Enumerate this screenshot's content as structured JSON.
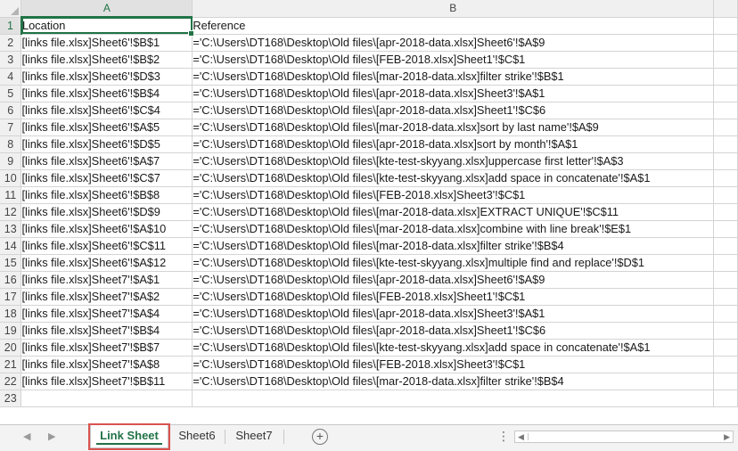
{
  "columns": [
    "A",
    "B"
  ],
  "rows": [
    {
      "n": "1",
      "a": "Location",
      "b": "Reference"
    },
    {
      "n": "2",
      "a": "[links file.xlsx]Sheet6'!$B$1",
      "b": "='C:\\Users\\DT168\\Desktop\\Old files\\[apr-2018-data.xlsx]Sheet6'!$A$9"
    },
    {
      "n": "3",
      "a": "[links file.xlsx]Sheet6'!$B$2",
      "b": "='C:\\Users\\DT168\\Desktop\\Old files\\[FEB-2018.xlsx]Sheet1'!$C$1"
    },
    {
      "n": "4",
      "a": "[links file.xlsx]Sheet6'!$D$3",
      "b": "='C:\\Users\\DT168\\Desktop\\Old files\\[mar-2018-data.xlsx]filter strike'!$B$1"
    },
    {
      "n": "5",
      "a": "[links file.xlsx]Sheet6'!$B$4",
      "b": "='C:\\Users\\DT168\\Desktop\\Old files\\[apr-2018-data.xlsx]Sheet3'!$A$1"
    },
    {
      "n": "6",
      "a": "[links file.xlsx]Sheet6'!$C$4",
      "b": "='C:\\Users\\DT168\\Desktop\\Old files\\[apr-2018-data.xlsx]Sheet1'!$C$6"
    },
    {
      "n": "7",
      "a": "[links file.xlsx]Sheet6'!$A$5",
      "b": "='C:\\Users\\DT168\\Desktop\\Old files\\[mar-2018-data.xlsx]sort by last name'!$A$9"
    },
    {
      "n": "8",
      "a": "[links file.xlsx]Sheet6'!$D$5",
      "b": "='C:\\Users\\DT168\\Desktop\\Old files\\[apr-2018-data.xlsx]sort by month'!$A$1"
    },
    {
      "n": "9",
      "a": "[links file.xlsx]Sheet6'!$A$7",
      "b": "='C:\\Users\\DT168\\Desktop\\Old files\\[kte-test-skyyang.xlsx]uppercase first letter'!$A$3"
    },
    {
      "n": "10",
      "a": "[links file.xlsx]Sheet6'!$C$7",
      "b": "='C:\\Users\\DT168\\Desktop\\Old files\\[kte-test-skyyang.xlsx]add space in concatenate'!$A$1"
    },
    {
      "n": "11",
      "a": "[links file.xlsx]Sheet6'!$B$8",
      "b": "='C:\\Users\\DT168\\Desktop\\Old files\\[FEB-2018.xlsx]Sheet3'!$C$1"
    },
    {
      "n": "12",
      "a": "[links file.xlsx]Sheet6'!$D$9",
      "b": "='C:\\Users\\DT168\\Desktop\\Old files\\[mar-2018-data.xlsx]EXTRACT UNIQUE'!$C$11"
    },
    {
      "n": "13",
      "a": "[links file.xlsx]Sheet6'!$A$10",
      "b": "='C:\\Users\\DT168\\Desktop\\Old files\\[mar-2018-data.xlsx]combine with line break'!$E$1"
    },
    {
      "n": "14",
      "a": "[links file.xlsx]Sheet6'!$C$11",
      "b": "='C:\\Users\\DT168\\Desktop\\Old files\\[mar-2018-data.xlsx]filter strike'!$B$4"
    },
    {
      "n": "15",
      "a": "[links file.xlsx]Sheet6'!$A$12",
      "b": "='C:\\Users\\DT168\\Desktop\\Old files\\[kte-test-skyyang.xlsx]multiple find and replace'!$D$1"
    },
    {
      "n": "16",
      "a": "[links file.xlsx]Sheet7'!$A$1",
      "b": "='C:\\Users\\DT168\\Desktop\\Old files\\[apr-2018-data.xlsx]Sheet6'!$A$9"
    },
    {
      "n": "17",
      "a": "[links file.xlsx]Sheet7'!$A$2",
      "b": "='C:\\Users\\DT168\\Desktop\\Old files\\[FEB-2018.xlsx]Sheet1'!$C$1"
    },
    {
      "n": "18",
      "a": "[links file.xlsx]Sheet7'!$A$4",
      "b": "='C:\\Users\\DT168\\Desktop\\Old files\\[apr-2018-data.xlsx]Sheet3'!$A$1"
    },
    {
      "n": "19",
      "a": "[links file.xlsx]Sheet7'!$B$4",
      "b": "='C:\\Users\\DT168\\Desktop\\Old files\\[apr-2018-data.xlsx]Sheet1'!$C$6"
    },
    {
      "n": "20",
      "a": "[links file.xlsx]Sheet7'!$B$7",
      "b": "='C:\\Users\\DT168\\Desktop\\Old files\\[kte-test-skyyang.xlsx]add space in concatenate'!$A$1"
    },
    {
      "n": "21",
      "a": "[links file.xlsx]Sheet7'!$A$8",
      "b": "='C:\\Users\\DT168\\Desktop\\Old files\\[FEB-2018.xlsx]Sheet3'!$C$1"
    },
    {
      "n": "22",
      "a": "[links file.xlsx]Sheet7'!$B$11",
      "b": "='C:\\Users\\DT168\\Desktop\\Old files\\[mar-2018-data.xlsx]filter strike'!$B$4"
    },
    {
      "n": "23",
      "a": "",
      "b": ""
    }
  ],
  "tabs": {
    "nav_prev": "◀",
    "nav_next": "▶",
    "items": [
      {
        "label": "Link Sheet",
        "active": true
      },
      {
        "label": "Sheet6",
        "active": false
      },
      {
        "label": "Sheet7",
        "active": false
      }
    ],
    "add_symbol": "+",
    "options_symbol": "⋮"
  },
  "scrollbar": {
    "left_arrow": "◀",
    "right_arrow": "▶"
  },
  "colors": {
    "accent": "#217346",
    "tab_highlight": "#d9534f"
  }
}
